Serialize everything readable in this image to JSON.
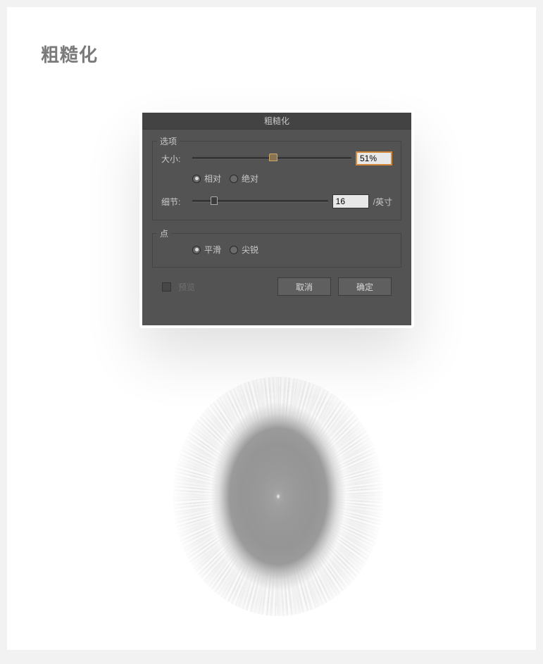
{
  "page": {
    "title": "粗糙化"
  },
  "dialog": {
    "title": "粗糙化",
    "options_legend": "选项",
    "size": {
      "label": "大小:",
      "value": "51%",
      "slider_position_pct": 51,
      "mode_relative": "相对",
      "mode_absolute": "绝对",
      "mode_selected": "relative"
    },
    "detail": {
      "label": "细节:",
      "value": "16",
      "unit": "/英寸",
      "slider_position_pct": 16
    },
    "point": {
      "legend": "点",
      "smooth": "平滑",
      "sharp": "尖锐",
      "selected": "smooth"
    },
    "preview_label": "预览",
    "preview_checked": false,
    "buttons": {
      "cancel": "取消",
      "ok": "确定"
    }
  }
}
